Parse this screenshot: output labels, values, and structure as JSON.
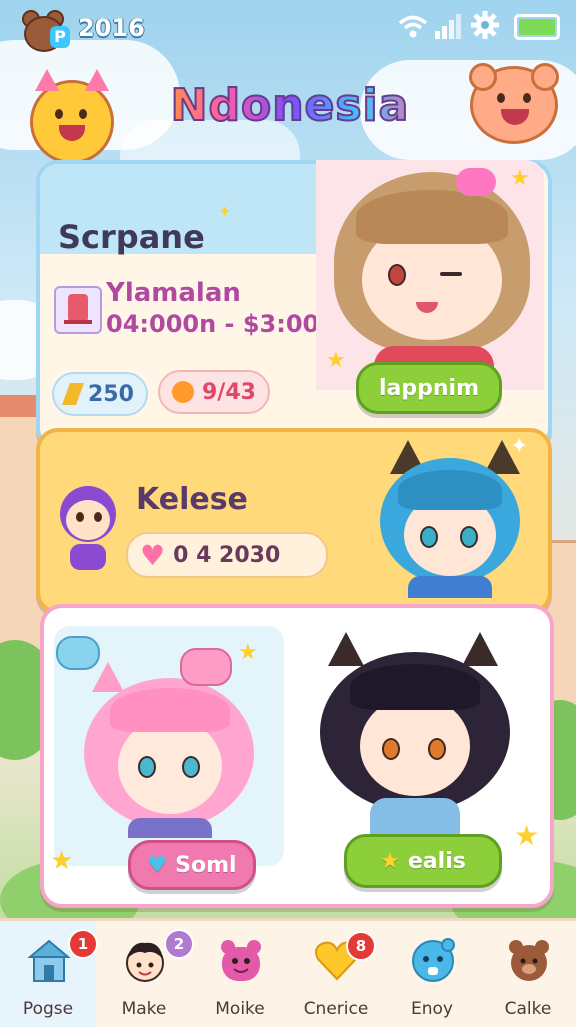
{
  "status_bar": {
    "time": "2016",
    "icons": [
      "bear-avatar-icon",
      "wifi-icon",
      "signal-icon",
      "gear-icon",
      "battery-icon"
    ]
  },
  "app": {
    "title": "Ndonesia"
  },
  "cards": [
    {
      "title": "Scrpane",
      "item_name": "Ylamalan",
      "item_detail": "04:000n - $3:00",
      "stat_1": "250",
      "stat_2": "9/43",
      "button": "lappnim"
    },
    {
      "title": "Kelese",
      "counter": "0 4 2030"
    },
    {
      "button_left": "Soml",
      "button_right": "ealis"
    }
  ],
  "nav": {
    "items": [
      {
        "label": "Pogse",
        "icon": "house-icon",
        "badge": "1",
        "active": true
      },
      {
        "label": "Make",
        "icon": "boy-face-icon",
        "badge": "2"
      },
      {
        "label": "Moike",
        "icon": "pink-monster-icon"
      },
      {
        "label": "Cnerice",
        "icon": "heart-icon",
        "badge": "8"
      },
      {
        "label": "Enoy",
        "icon": "blue-blob-icon"
      },
      {
        "label": "Calke",
        "icon": "bear-icon"
      }
    ]
  },
  "colors": {
    "accent_green": "#8ccf3a",
    "accent_pink": "#f07ab0",
    "card_blue": "#bfe6f7",
    "card_yellow": "#ffd97a",
    "badge_red": "#e53935"
  }
}
